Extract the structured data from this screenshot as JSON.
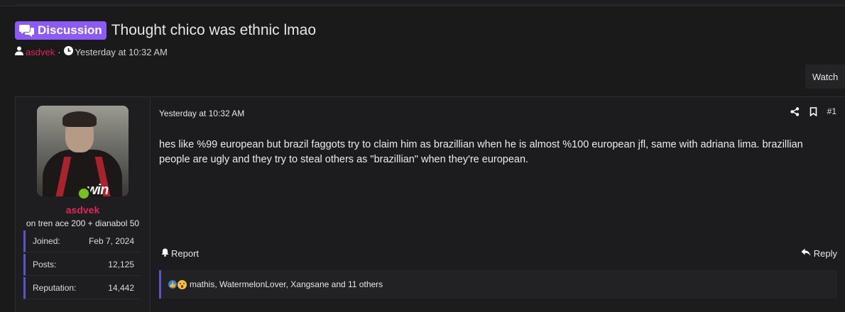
{
  "thread": {
    "prefix": "Discussion",
    "title": "Thought chico was ethnic lmao",
    "author": "asdvek",
    "separator": "·",
    "time": "Yesterday at 10:32 AM",
    "watch_label": "Watch"
  },
  "post": {
    "user": {
      "name": "asdvek",
      "user_title": "on tren ace 200 + dianabol 50",
      "online": true,
      "stats": [
        {
          "label": "Joined:",
          "value": "Feb 7, 2024"
        },
        {
          "label": "Posts:",
          "value": "12,125"
        },
        {
          "label": "Reputation:",
          "value": "14,442"
        }
      ]
    },
    "time": "Yesterday at 10:32 AM",
    "number": "#1",
    "body": "hes like %99 european but brazil faggots try to claim him as brazillian when he is almost %100 european jfl, same with adriana lima. brazillian people are ugly and they try to steal others as \"brazillian\" when they're european.",
    "report_label": "Report",
    "reply_label": "Reply",
    "reactions_text": "mathis, WatermelonLover, Xangsane and 11 others",
    "reaction_icons": [
      "like-icon",
      "wow-icon"
    ]
  },
  "colors": {
    "background": "#1a1a1b",
    "accent": "#8a5cf5",
    "username": "#e0245e",
    "stat_border": "#5a55c8",
    "online": "#7ac21b"
  }
}
